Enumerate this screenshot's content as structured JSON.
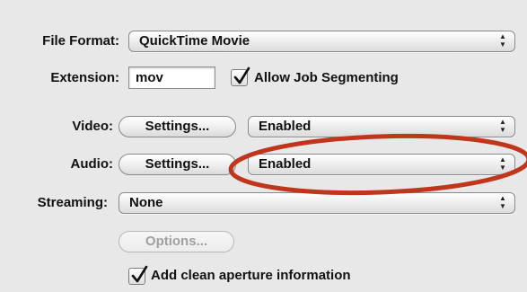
{
  "file_format": {
    "label": "File Format:",
    "value": "QuickTime Movie"
  },
  "extension": {
    "label": "Extension:",
    "value": "mov"
  },
  "allow_job_segmenting": {
    "label": "Allow Job Segmenting",
    "checked": true
  },
  "video": {
    "label": "Video:",
    "settings_label": "Settings...",
    "value": "Enabled"
  },
  "audio": {
    "label": "Audio:",
    "settings_label": "Settings...",
    "value": "Enabled"
  },
  "streaming": {
    "label": "Streaming:",
    "value": "None"
  },
  "options_button": {
    "label": "Options...",
    "enabled": false
  },
  "clean_aperture": {
    "label": "Add clean aperture information",
    "checked": true
  },
  "annotation": {
    "type": "ellipse",
    "color": "#c0361c",
    "target": "audio-select"
  },
  "icons": {
    "popup_arrows": "updown-arrows-icon",
    "checkmark": "checkmark-icon"
  }
}
